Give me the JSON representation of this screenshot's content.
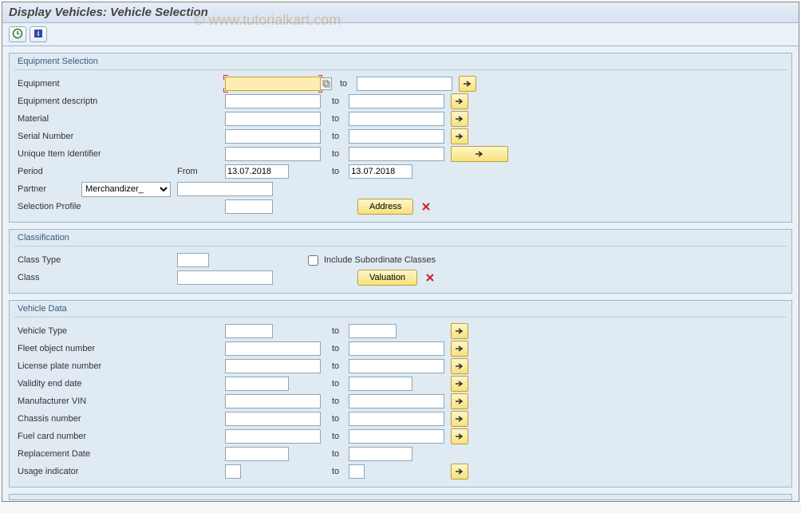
{
  "title": "Display Vehicles: Vehicle Selection",
  "watermark": "© www.tutorialkart.com",
  "toText": "to",
  "fromText": "From",
  "equipSel": {
    "title": "Equipment Selection",
    "rows": {
      "equipment": "Equipment",
      "equipDesc": "Equipment descriptn",
      "material": "Material",
      "serial": "Serial Number",
      "uii": "Unique Item Identifier",
      "period": "Period",
      "partner": "Partner",
      "selProfile": "Selection Profile"
    },
    "periodFrom": "13.07.2018",
    "periodTo": "13.07.2018",
    "partnerOption": "Merchandizer_",
    "addressBtn": "Address"
  },
  "classification": {
    "title": "Classification",
    "classType": "Class Type",
    "class": "Class",
    "includeSub": "Include Subordinate Classes",
    "valuationBtn": "Valuation"
  },
  "vehicleData": {
    "title": "Vehicle Data",
    "labels": {
      "vehicleType": "Vehicle Type",
      "fleet": "Fleet object number",
      "plate": "License plate number",
      "validity": "Validity end date",
      "vin": "Manufacturer VIN",
      "chassis": "Chassis number",
      "fuel": "Fuel card number",
      "replace": "Replacement Date",
      "usage": "Usage indicator"
    }
  }
}
